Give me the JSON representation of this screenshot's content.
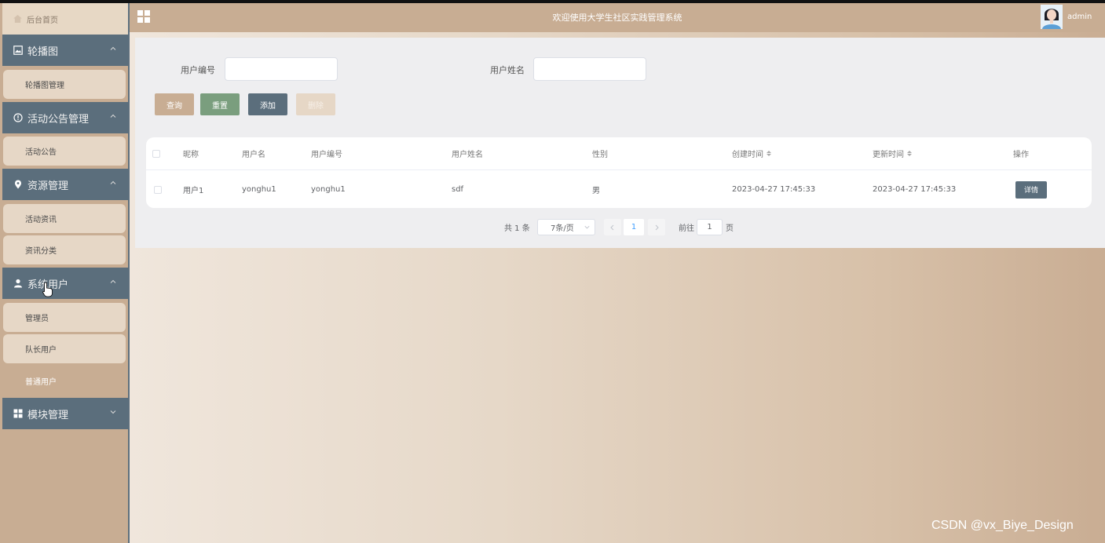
{
  "header": {
    "title": "欢迎使用大学生社区实践管理系统",
    "username": "admin"
  },
  "sidebar": {
    "home": "后台首页",
    "groups": [
      {
        "label": "轮播图",
        "items": [
          "轮播图管理"
        ]
      },
      {
        "label": "活动公告管理",
        "items": [
          "活动公告"
        ]
      },
      {
        "label": "资源管理",
        "items": [
          "活动资讯",
          "资讯分类"
        ]
      },
      {
        "label": "系统用户",
        "items": [
          "管理员",
          "队长用户",
          "普通用户"
        ],
        "active_item": "普通用户"
      },
      {
        "label": "模块管理",
        "items": []
      }
    ]
  },
  "search": {
    "field1_label": "用户编号",
    "field1_value": "",
    "field2_label": "用户姓名",
    "field2_value": ""
  },
  "buttons": {
    "query": "查询",
    "reset": "重置",
    "add": "添加",
    "delete": "删除"
  },
  "table": {
    "columns": [
      "昵称",
      "用户名",
      "用户编号",
      "用户姓名",
      "性别",
      "创建时间",
      "更新时间",
      "操作"
    ],
    "rows": [
      {
        "nickname": "用户1",
        "username": "yonghu1",
        "user_no": "yonghu1",
        "real_name": "sdf",
        "gender": "男",
        "created": "2023-04-27 17:45:33",
        "updated": "2023-04-27 17:45:33",
        "action": "详情"
      }
    ]
  },
  "pagination": {
    "total_text": "共 1 条",
    "page_size": "7条/页",
    "current_page": "1",
    "goto_label": "前往",
    "goto_value": "1",
    "page_suffix": "页"
  },
  "watermark": "CSDN @vx_Biye_Design",
  "colors": {
    "header_bg": "#c8ad93",
    "menu_group_bg": "#5b6e7c",
    "reset_btn": "#7a9e7e",
    "add_btn": "#5b6e7c"
  }
}
